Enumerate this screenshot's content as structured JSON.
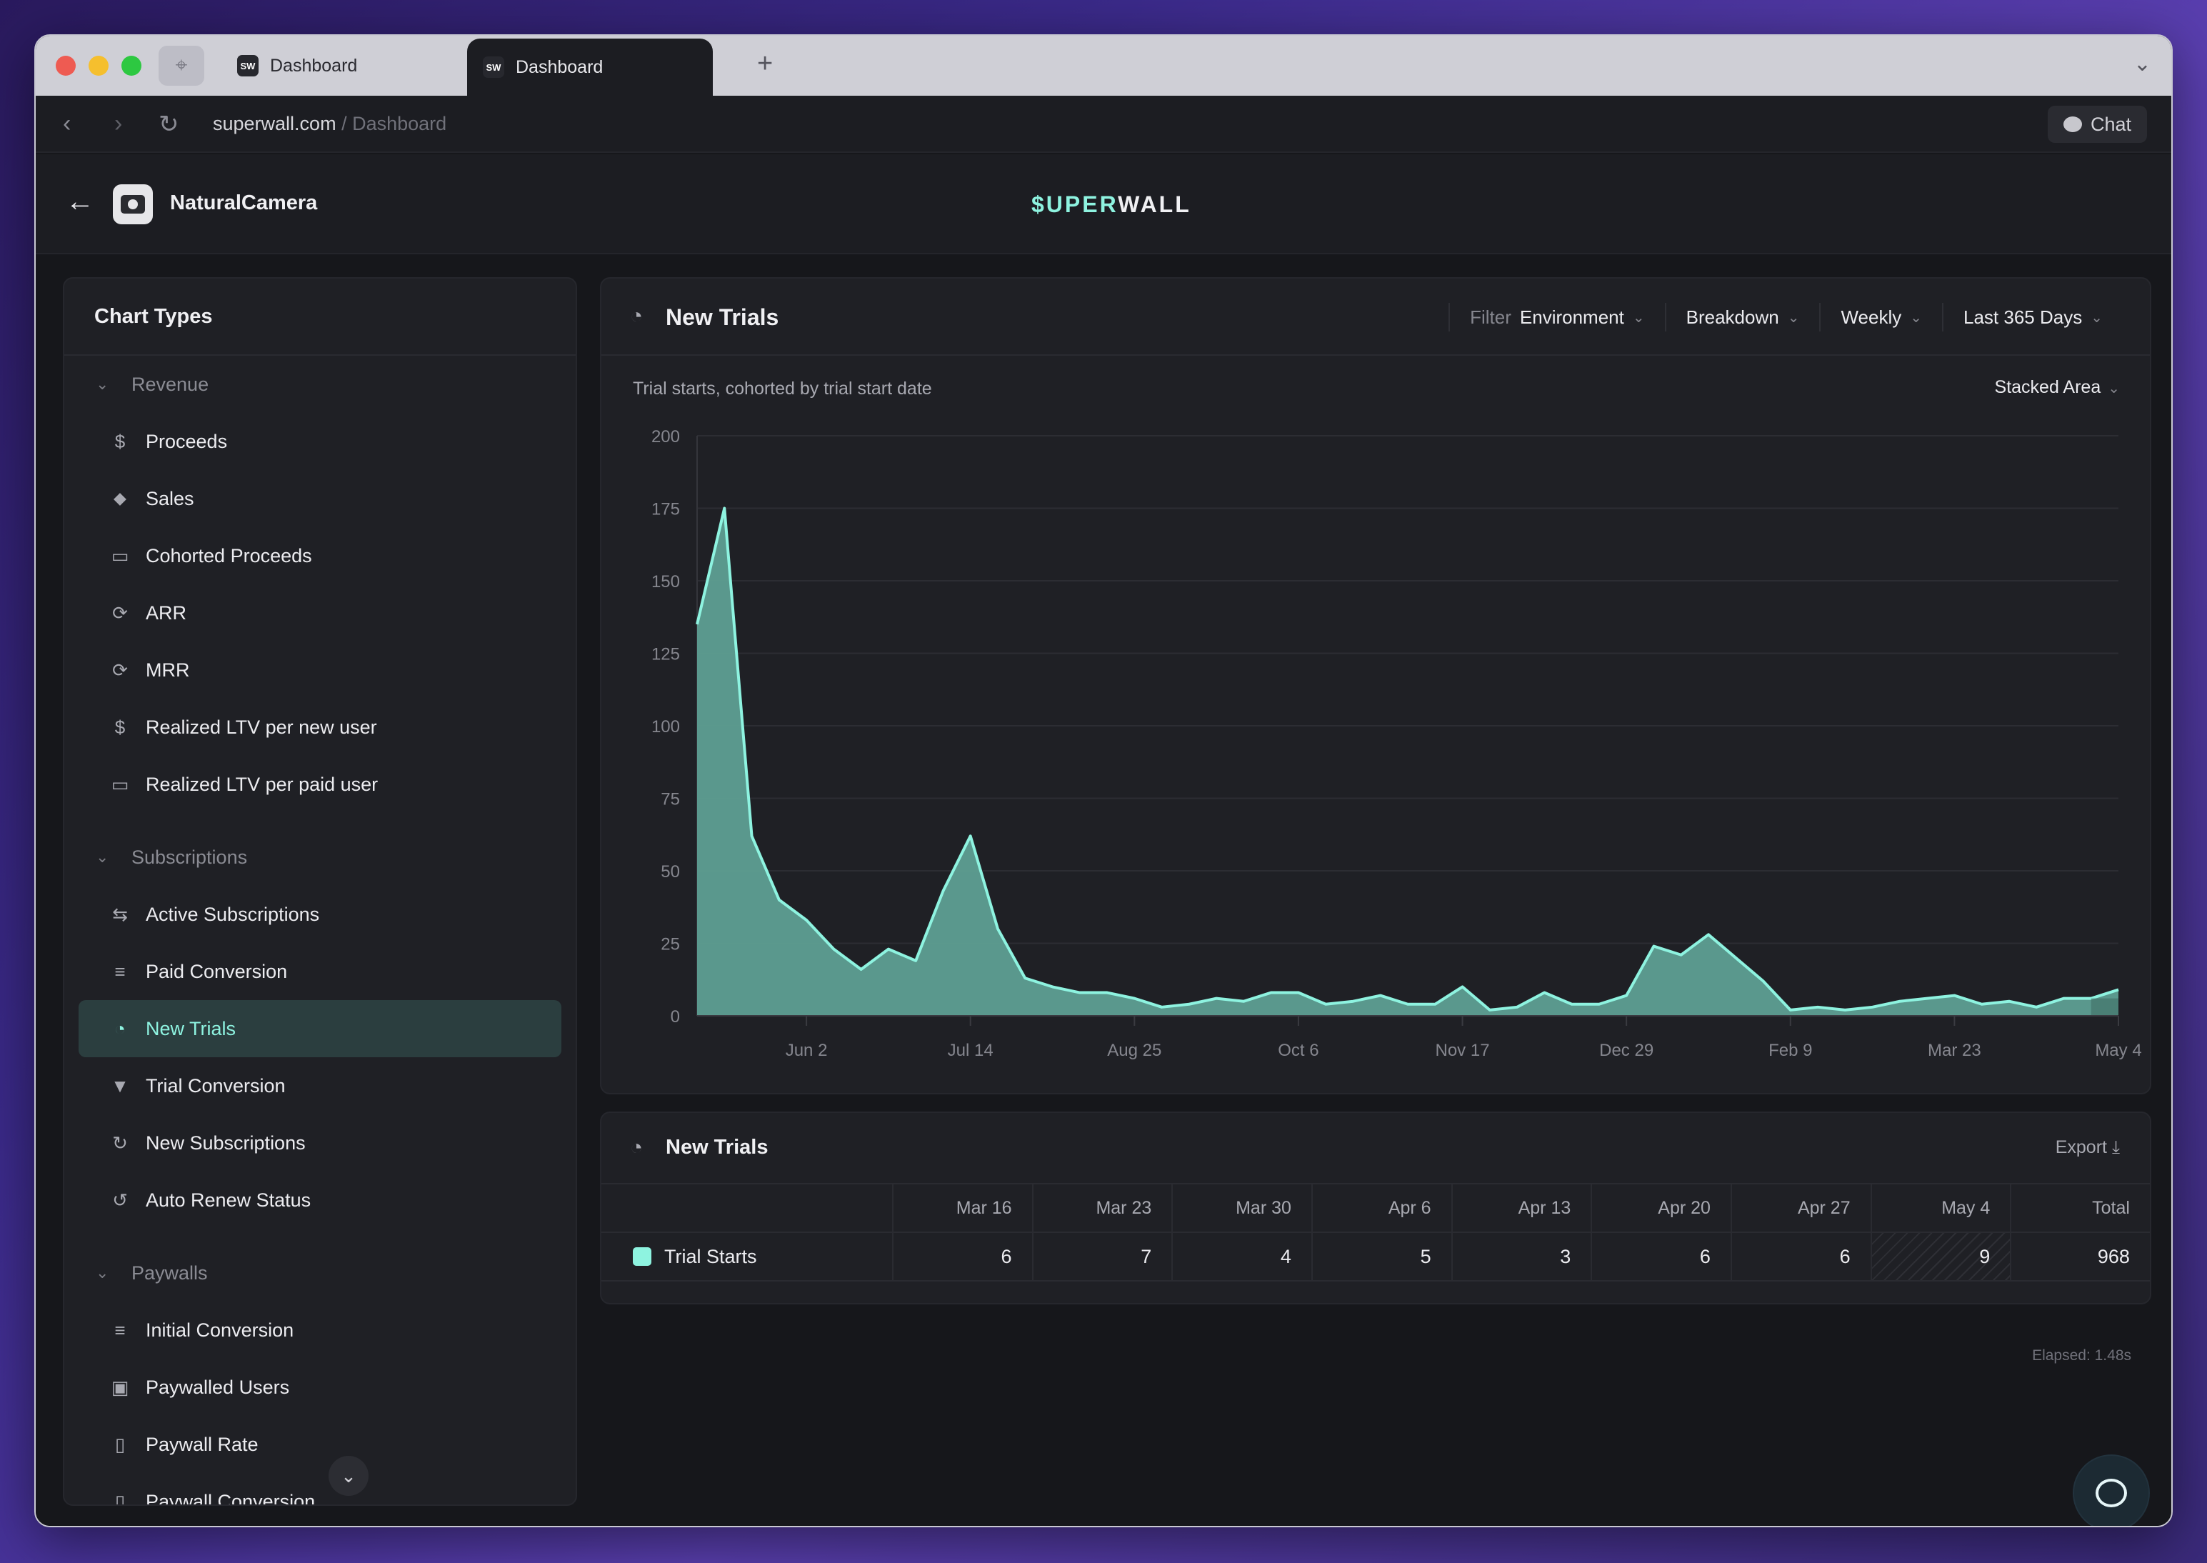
{
  "browser": {
    "tabs": [
      {
        "favicon": "SW",
        "label": "Dashboard"
      },
      {
        "favicon": "SW",
        "label": "Dashboard"
      }
    ],
    "url_host": "superwall.com",
    "url_path": " / Dashboard",
    "chat_label": "Chat"
  },
  "header": {
    "app_name": "NaturalCamera",
    "logo_accent": "$UPER",
    "logo_rest": "WALL"
  },
  "sidebar": {
    "title": "Chart Types",
    "groups": [
      {
        "label": "Revenue",
        "items": [
          {
            "icon": "dollar-icon",
            "glyph": "$",
            "label": "Proceeds"
          },
          {
            "icon": "tag-icon",
            "glyph": "⬥",
            "label": "Sales"
          },
          {
            "icon": "calendar-icon",
            "glyph": "▭",
            "label": "Cohorted Proceeds"
          },
          {
            "icon": "recurring-icon",
            "glyph": "⟳",
            "label": "ARR"
          },
          {
            "icon": "recurring-icon",
            "glyph": "⟳",
            "label": "MRR"
          },
          {
            "icon": "dollar-icon",
            "glyph": "$",
            "label": "Realized LTV per new user"
          },
          {
            "icon": "calendar-icon",
            "glyph": "▭",
            "label": "Realized LTV per paid user"
          }
        ]
      },
      {
        "label": "Subscriptions",
        "items": [
          {
            "icon": "repeat-icon",
            "glyph": "⇆",
            "label": "Active Subscriptions"
          },
          {
            "icon": "filter-lines-icon",
            "glyph": "≡",
            "label": "Paid Conversion"
          },
          {
            "icon": "timer-icon",
            "glyph": "◔",
            "label": "New Trials",
            "active": true
          },
          {
            "icon": "funnel-icon",
            "glyph": "▼",
            "label": "Trial Conversion"
          },
          {
            "icon": "refresh-icon",
            "glyph": "↻",
            "label": "New Subscriptions"
          },
          {
            "icon": "auto-renew-icon",
            "glyph": "↺",
            "label": "Auto Renew Status"
          }
        ]
      },
      {
        "label": "Paywalls",
        "items": [
          {
            "icon": "filter-lines-icon",
            "glyph": "≡",
            "label": "Initial Conversion"
          },
          {
            "icon": "badge-icon",
            "glyph": "▣",
            "label": "Paywalled Users"
          },
          {
            "icon": "phone-icon",
            "glyph": "▯",
            "label": "Paywall Rate"
          },
          {
            "icon": "phone-icon",
            "glyph": "▯",
            "label": "Paywall Conversion"
          }
        ]
      }
    ]
  },
  "chart_card": {
    "title": "New Trials",
    "filter_label": "Filter",
    "filter_value": "Environment",
    "breakdown": "Breakdown",
    "interval": "Weekly",
    "range": "Last 365 Days",
    "subtitle": "Trial starts, cohorted by trial start date",
    "chart_type": "Stacked Area"
  },
  "chart_data": {
    "type": "area",
    "title": "New Trials",
    "subtitle": "Trial starts, cohorted by trial start date",
    "ylim": [
      0,
      200
    ],
    "yticks": [
      0,
      25,
      50,
      75,
      100,
      125,
      150,
      175,
      200
    ],
    "xtick_labels": [
      "Jun 2",
      "Jul 14",
      "Aug 25",
      "Oct 6",
      "Nov 17",
      "Dec 29",
      "Feb 9",
      "Mar 23",
      "May 4"
    ],
    "xtick_index": [
      4,
      10,
      16,
      22,
      28,
      34,
      40,
      46,
      52
    ],
    "grid": true,
    "series": [
      {
        "name": "Trial Starts",
        "color": "#8ef3e0",
        "values": [
          135,
          175,
          62,
          40,
          33,
          23,
          16,
          23,
          19,
          43,
          62,
          30,
          13,
          10,
          8,
          8,
          6,
          3,
          4,
          6,
          5,
          8,
          8,
          4,
          5,
          7,
          4,
          4,
          10,
          2,
          3,
          8,
          4,
          4,
          7,
          24,
          21,
          28,
          20,
          12,
          2,
          3,
          2,
          3,
          5,
          6,
          7,
          4,
          5,
          3,
          6,
          6,
          9
        ]
      }
    ]
  },
  "table_card": {
    "title": "New Trials",
    "export_label": "Export",
    "columns": [
      "Mar 16",
      "Mar 23",
      "Mar 30",
      "Apr 6",
      "Apr 13",
      "Apr 20",
      "Apr 27",
      "May 4",
      "Total"
    ],
    "rows": [
      {
        "label": "Trial Starts",
        "values": [
          "6",
          "7",
          "4",
          "5",
          "3",
          "6",
          "6",
          "9",
          "968"
        ]
      }
    ]
  },
  "footer": {
    "elapsed": "Elapsed: 1.48s"
  }
}
